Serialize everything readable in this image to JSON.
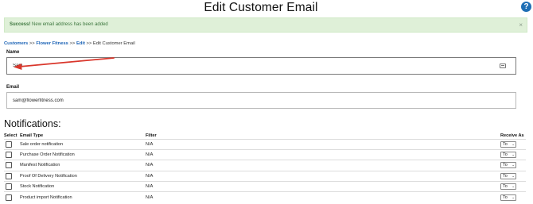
{
  "page": {
    "title": "Edit Customer Email",
    "help_icon": "question-mark-circle-icon"
  },
  "alert": {
    "strong": "Success!",
    "message": "New email address has been added",
    "close": "×",
    "color": "#dff0d8"
  },
  "breadcrumb": {
    "items": [
      "Customers",
      "Flower Fitness",
      "Edit"
    ],
    "separator": ">>",
    "current": "Edit Customer Email"
  },
  "form": {
    "name_label": "Name",
    "name_value": "Sam",
    "email_label": "Email",
    "email_value": "sam@flowerfitness.com"
  },
  "notifications": {
    "title": "Notifications:",
    "headers": {
      "select": "Select",
      "type": "Email Type",
      "filter": "Filter",
      "receive": "Receive As"
    },
    "rows": [
      {
        "type": "Sale order notification",
        "filter": "N/A",
        "receive": "To"
      },
      {
        "type": "Purchase Order Notification",
        "filter": "N/A",
        "receive": "To"
      },
      {
        "type": "Manifest Notification",
        "filter": "N/A",
        "receive": "To"
      },
      {
        "type": "Proof Of Delivery Notification",
        "filter": "N/A",
        "receive": "To"
      },
      {
        "type": "Stock Notification",
        "filter": "N/A",
        "receive": "To"
      },
      {
        "type": "Product import Notification",
        "filter": "N/A",
        "receive": "To"
      }
    ]
  },
  "annotation": {
    "arrow_color": "#d9362b"
  }
}
